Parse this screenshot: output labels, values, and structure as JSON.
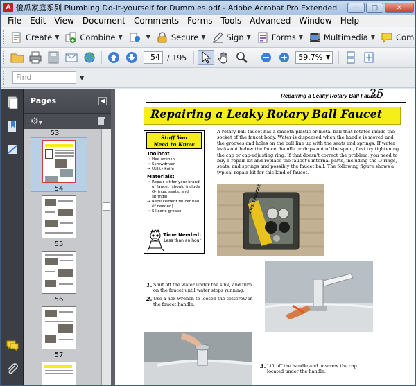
{
  "window": {
    "title": "傻瓜家庭系列 Plumbing Do-it-yourself for Dummies.pdf - Adobe Acrobat Pro Extended",
    "app_icon": "acrobat-icon"
  },
  "menu": [
    "File",
    "Edit",
    "View",
    "Document",
    "Comments",
    "Forms",
    "Tools",
    "Advanced",
    "Window",
    "Help"
  ],
  "task_toolbar": {
    "create": "Create",
    "combine": "Combine",
    "secure": "Secure",
    "sign": "Sign",
    "forms": "Forms",
    "multimedia": "Multimedia",
    "comment": "Comment"
  },
  "nav_toolbar": {
    "current_page": "54",
    "total_pages": "/ 195",
    "zoom": "59.7%"
  },
  "find": {
    "placeholder": "Find"
  },
  "pages_panel": {
    "title": "Pages",
    "thumbnails": [
      {
        "label": "53"
      },
      {
        "label": "54",
        "selected": true
      },
      {
        "label": "55"
      },
      {
        "label": "56"
      },
      {
        "label": "57"
      }
    ]
  },
  "document": {
    "running_head": "Repairing a Leaky Rotary Ball Faucet",
    "page_number": "35",
    "heading": "Repairing a Leaky Rotary Ball Faucet",
    "sidebox": {
      "title_line1": "Stuff You",
      "title_line2": "Need to Know",
      "toolbox_title": "Toolbox:",
      "toolbox": [
        "Hex wrench",
        "Screwdriver",
        "Utility knife"
      ],
      "materials_title": "Materials:",
      "materials": [
        "Repair kit for your brand of faucet (should include O-rings, seats, and springs)",
        "Replacement faucet ball (if needed)",
        "Silicone grease"
      ],
      "time_title": "Time Needed:",
      "time_value": "Less than an hour"
    },
    "intro": "A rotary ball faucet has a smooth plastic or metal ball that rotates inside the socket of the faucet body. Water is dispensed when the handle is moved and the grooves and holes on the ball line up with the seats and springs. If water leaks out below the faucet handle or drips out of the spout, first try tightening the cap or cap-adjusting ring. If that doesn't correct the problem, you need to buy a repair kit and replace the faucet's internal parts, including the O-rings, seats, and springs and possibly the faucet ball. The following figure shows a typical repair kit for this kind of faucet.",
    "kit_label": "SINGLE HANDLE",
    "steps": [
      {
        "num": "1.",
        "text": "Shut off the water under the sink, and turn on the faucet until water stops running."
      },
      {
        "num": "2.",
        "text": "Use a hex wrench to loosen the setscrew in the faucet handle."
      },
      {
        "num": "3.",
        "text": "Lift off the handle and unscrew the cap located under the handle."
      }
    ]
  }
}
